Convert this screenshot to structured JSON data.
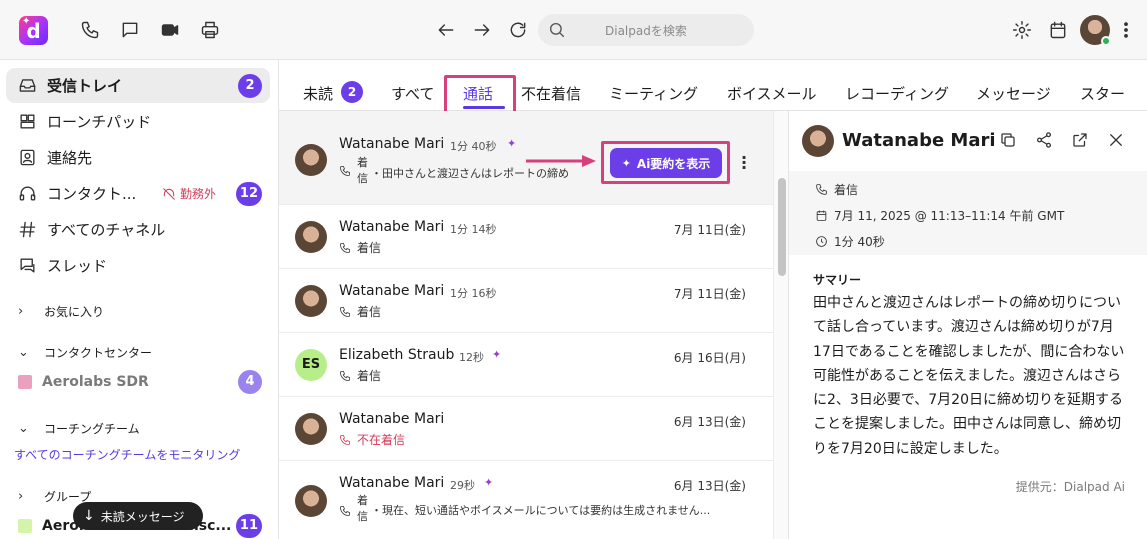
{
  "app": {
    "logo_letter": "d",
    "search_placeholder": "Dialpadを検索"
  },
  "sidebar": {
    "items": [
      {
        "label": "受信トレイ",
        "icon": "inbox-icon",
        "badge": "2"
      },
      {
        "label": "ローンチパッド",
        "icon": "launchpad-icon"
      },
      {
        "label": "連絡先",
        "icon": "contacts-icon"
      },
      {
        "label": "コンタクト...",
        "icon": "headset-icon",
        "status": "勤務外",
        "badge": "12"
      },
      {
        "label": "すべてのチャネル",
        "icon": "hash-icon"
      },
      {
        "label": "スレッド",
        "icon": "threads-icon"
      }
    ],
    "sections": {
      "favorites": "お気に入り",
      "contact_center": "コンタクトセンター",
      "aerolabs_sdr": "Aerolabs SDR",
      "aerolabs_sdr_badge": "4",
      "coaching_team": "コーチングチーム",
      "monitor_link": "すべてのコーチングチームをモニタリング",
      "groups": "グループ",
      "group_item": "Aerolabs San Francisc...",
      "group_badge": "11"
    },
    "unread_pill": "未読メッセージ"
  },
  "tabs": [
    {
      "label": "未読",
      "badge": "2"
    },
    {
      "label": "すべて"
    },
    {
      "label": "通話",
      "active": true
    },
    {
      "label": "不在着信"
    },
    {
      "label": "ミーティング"
    },
    {
      "label": "ボイスメール"
    },
    {
      "label": "レコーディング"
    },
    {
      "label": "メッセージ"
    },
    {
      "label": "スター"
    }
  ],
  "calls": [
    {
      "name": "Watanabe Mari",
      "duration": "1分 40秒",
      "ai": true,
      "type_stacked": [
        "着",
        "信"
      ],
      "summary": "・田中さんと渡辺さんはレポートの締め",
      "ai_button": "Ai要約を表示"
    },
    {
      "name": "Watanabe Mari",
      "duration": "1分 14秒",
      "date": "7月 11日(金)",
      "type": "着信"
    },
    {
      "name": "Watanabe Mari",
      "duration": "1分 16秒",
      "date": "7月 11日(金)",
      "type": "着信"
    },
    {
      "name": "Elizabeth Straub",
      "initials": "ES",
      "duration": "12秒",
      "ai": true,
      "date": "6月 16日(月)",
      "type": "着信"
    },
    {
      "name": "Watanabe Mari",
      "date": "6月 13日(金)",
      "type": "不在着信",
      "missed": true
    },
    {
      "name": "Watanabe Mari",
      "duration": "29秒",
      "ai": true,
      "date": "6月 13日(金)",
      "type_stacked": [
        "着",
        "信"
      ],
      "summary": "・現在、短い通話やボイスメールについては要約は生成されません..."
    }
  ],
  "detail": {
    "name": "Watanabe Mari",
    "call_type": "着信",
    "datetime": "7月 11, 2025 @ 11:13–11:14 午前 GMT",
    "duration": "1分 40秒",
    "summary_title": "サマリー",
    "summary_text": "田中さんと渡辺さんはレポートの締め切りについて話し合っています。渡辺さんは締め切りが7月17日であることを確認しましたが、間に合わない可能性があることを伝えました。渡辺さんはさらに2、3日必要で、7月20日に締め切りを延期することを提案しました。田中さんは同意し、締め切りを7月20日に設定しました。",
    "provider": "提供元：Dialpad Ai"
  },
  "colors": {
    "accent": "#6b3ee8",
    "highlight": "#d7407d",
    "missed": "#d23c5a"
  }
}
